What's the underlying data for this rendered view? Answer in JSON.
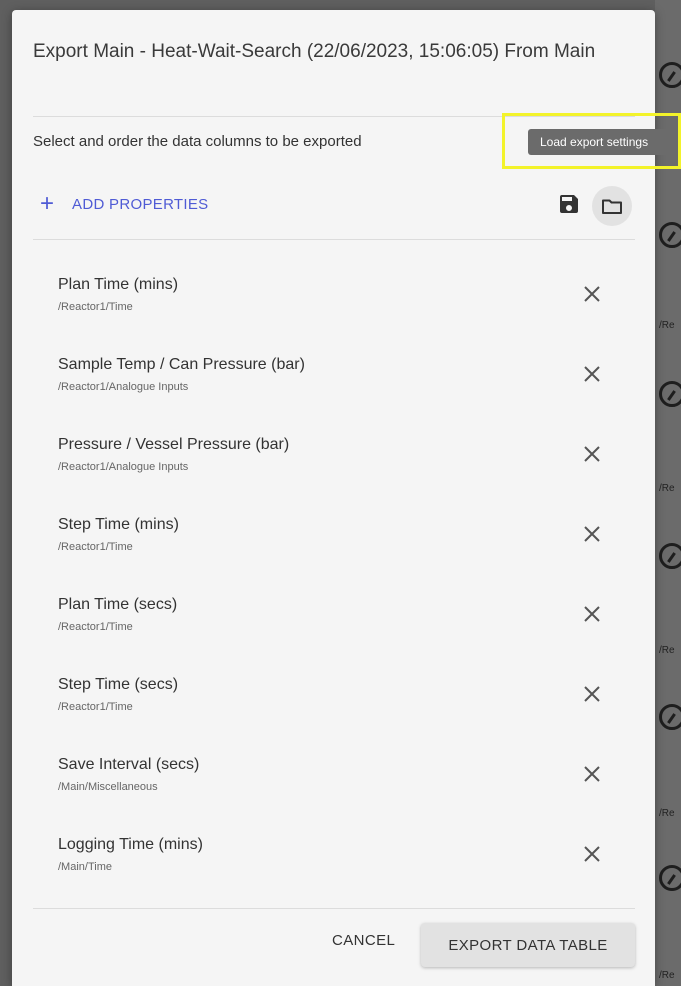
{
  "background": {
    "path_texts": [
      "/Re",
      "/Re",
      "/Re",
      "/Re",
      "/Re"
    ]
  },
  "dialog": {
    "title": "Export Main - Heat-Wait-Search (22/06/2023, 15:06:05) From Main",
    "subtitle": "Select and order the data columns to be exported",
    "add_properties_label": "ADD PROPERTIES",
    "add_icon": "plus-icon",
    "save_icon": "save-icon",
    "folder_icon": "folder-icon",
    "tooltip": "Load export settings",
    "columns": [
      {
        "name": "Plan Time (mins)",
        "path": "/Reactor1/Time"
      },
      {
        "name": "Sample Temp / Can Pressure (bar)",
        "path": "/Reactor1/Analogue Inputs"
      },
      {
        "name": "Pressure / Vessel Pressure (bar)",
        "path": "/Reactor1/Analogue Inputs"
      },
      {
        "name": "Step Time (mins)",
        "path": "/Reactor1/Time"
      },
      {
        "name": "Plan Time (secs)",
        "path": "/Reactor1/Time"
      },
      {
        "name": "Step Time (secs)",
        "path": "/Reactor1/Time"
      },
      {
        "name": "Save Interval (secs)",
        "path": "/Main/Miscellaneous"
      },
      {
        "name": "Logging Time (mins)",
        "path": "/Main/Time"
      }
    ],
    "remove_icon": "close-icon",
    "cancel_label": "CANCEL",
    "export_label": "EXPORT DATA TABLE"
  },
  "colors": {
    "accent": "#4f5bd5",
    "highlight": "#f3f32a",
    "dialog_bg": "#f5f5f5"
  }
}
